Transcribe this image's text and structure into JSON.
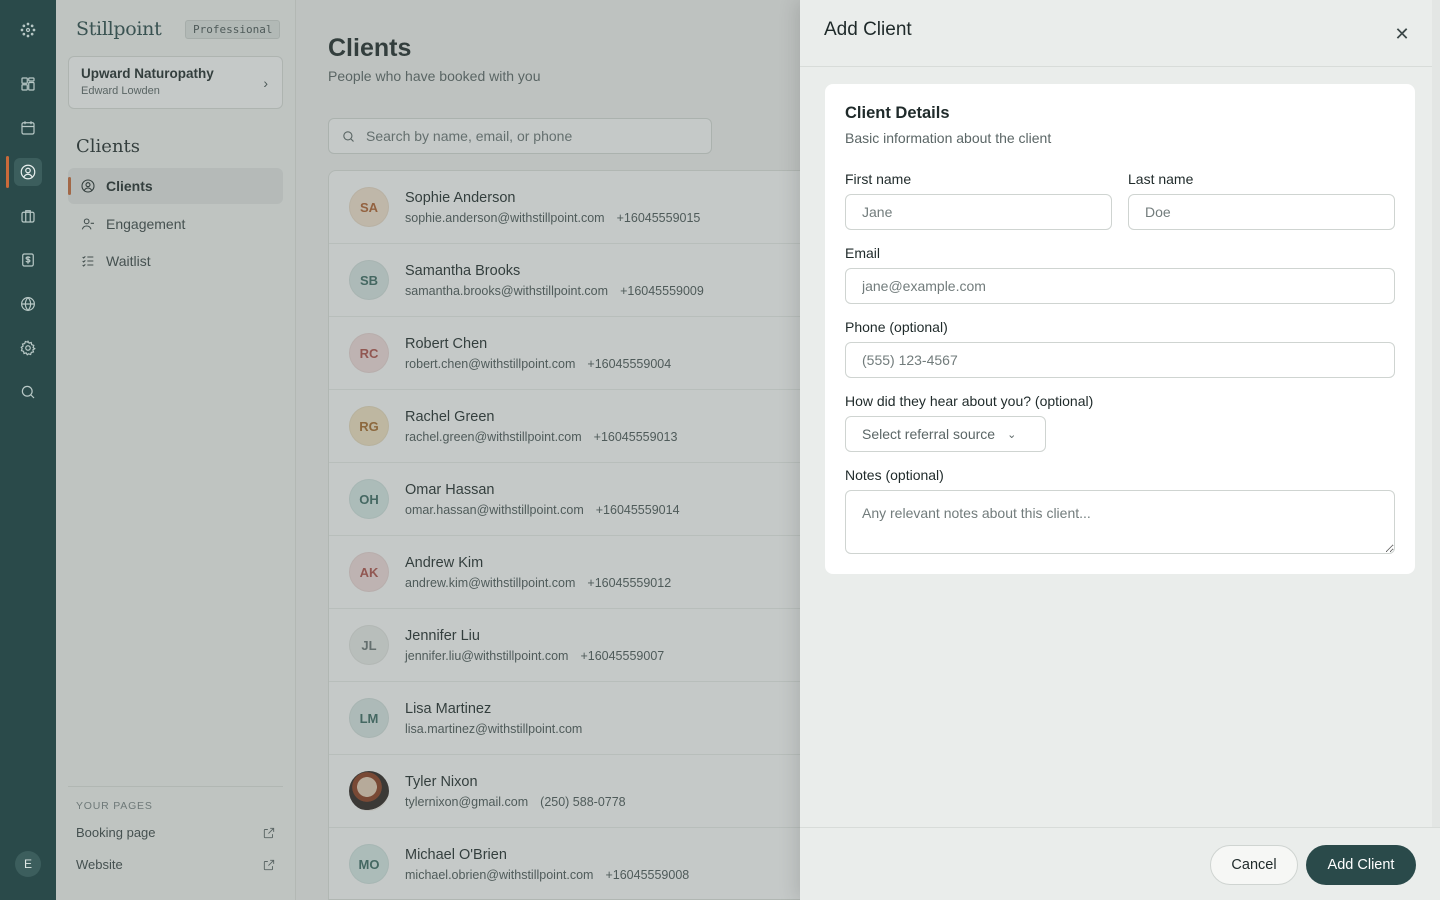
{
  "sidebar": {
    "brand": "Stillpoint",
    "plan": "Professional",
    "org_name": "Upward Naturopathy",
    "org_user": "Edward Lowden",
    "section": "Clients",
    "nav": [
      {
        "label": "Clients",
        "icon": "user-circle-icon"
      },
      {
        "label": "Engagement",
        "icon": "user-minus-icon"
      },
      {
        "label": "Waitlist",
        "icon": "checklist-icon"
      }
    ],
    "pages_title": "YOUR PAGES",
    "pages": [
      {
        "label": "Booking page",
        "icon": "external-link-icon"
      },
      {
        "label": "Website",
        "icon": "external-link-icon"
      }
    ]
  },
  "rail": {
    "avatar_initial": "E",
    "icons": [
      "logo-icon",
      "dashboard-icon",
      "calendar-icon",
      "clients-icon",
      "briefcase-icon",
      "billing-icon",
      "globe-icon",
      "settings-icon",
      "search-icon"
    ]
  },
  "main": {
    "title": "Clients",
    "subtitle": "People who have booked with you",
    "search_placeholder": "Search by name, email, or phone",
    "clients": [
      {
        "initials": "SA",
        "name": "Sophie Anderson",
        "email": "sophie.anderson@withstillpoint.com",
        "phone": "+16045559015"
      },
      {
        "initials": "SB",
        "name": "Samantha Brooks",
        "email": "samantha.brooks@withstillpoint.com",
        "phone": "+16045559009"
      },
      {
        "initials": "RC",
        "name": "Robert Chen",
        "email": "robert.chen@withstillpoint.com",
        "phone": "+16045559004"
      },
      {
        "initials": "RG",
        "name": "Rachel Green",
        "email": "rachel.green@withstillpoint.com",
        "phone": "+16045559013"
      },
      {
        "initials": "OH",
        "name": "Omar Hassan",
        "email": "omar.hassan@withstillpoint.com",
        "phone": "+16045559014"
      },
      {
        "initials": "AK",
        "name": "Andrew Kim",
        "email": "andrew.kim@withstillpoint.com",
        "phone": "+16045559012"
      },
      {
        "initials": "JL",
        "name": "Jennifer Liu",
        "email": "jennifer.liu@withstillpoint.com",
        "phone": "+16045559007"
      },
      {
        "initials": "LM",
        "name": "Lisa Martinez",
        "email": "lisa.martinez@withstillpoint.com",
        "phone": ""
      },
      {
        "initials": "",
        "name": "Tyler Nixon",
        "email": "tylernixon@gmail.com",
        "phone": "(250) 588-0778"
      },
      {
        "initials": "MO",
        "name": "Michael O'Brien",
        "email": "michael.obrien@withstillpoint.com",
        "phone": "+16045559008"
      }
    ]
  },
  "drawer": {
    "title": "Add Client",
    "close_icon": "close-icon",
    "card_title": "Client Details",
    "card_subtitle": "Basic information about the client",
    "first_name_label": "First name",
    "first_name_placeholder": "Jane",
    "last_name_label": "Last name",
    "last_name_placeholder": "Doe",
    "email_label": "Email",
    "email_placeholder": "jane@example.com",
    "phone_label": "Phone (optional)",
    "phone_placeholder": "(555) 123-4567",
    "referral_label": "How did they hear about you? (optional)",
    "referral_placeholder": "Select referral source",
    "notes_label": "Notes (optional)",
    "notes_placeholder": "Any relevant notes about this client...",
    "cancel_label": "Cancel",
    "submit_label": "Add Client"
  },
  "colors": {
    "rail_bg": "#2a4a4a",
    "accent": "#c96a3a",
    "primary_button": "#2a4a4a"
  }
}
